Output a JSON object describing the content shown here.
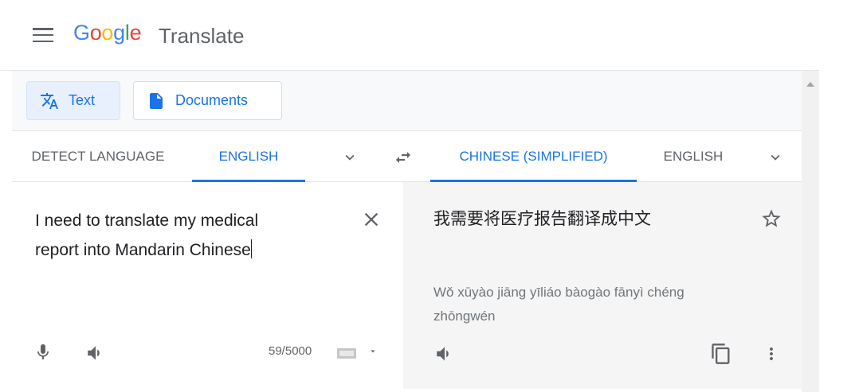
{
  "header": {
    "logo": [
      "G",
      "o",
      "o",
      "g",
      "l",
      "e"
    ],
    "logo_colors": [
      "#4285f4",
      "#ea4335",
      "#fbbc05",
      "#4285f4",
      "#34a853",
      "#ea4335"
    ],
    "app_name": "Translate"
  },
  "modes": {
    "text": "Text",
    "documents": "Documents"
  },
  "source_langs": [
    "DETECT LANGUAGE",
    "ENGLISH"
  ],
  "target_langs": [
    "CHINESE (SIMPLIFIED)",
    "ENGLISH"
  ],
  "source": {
    "line1": "I need to translate my medical",
    "line2": "report into Mandarin Chinese",
    "count": "59/5000"
  },
  "target": {
    "text": "我需要将医疗报告翻译成中文",
    "pinyin": "Wǒ xūyào jiāng yīliáo bàogào fānyì chéng zhōngwén"
  }
}
